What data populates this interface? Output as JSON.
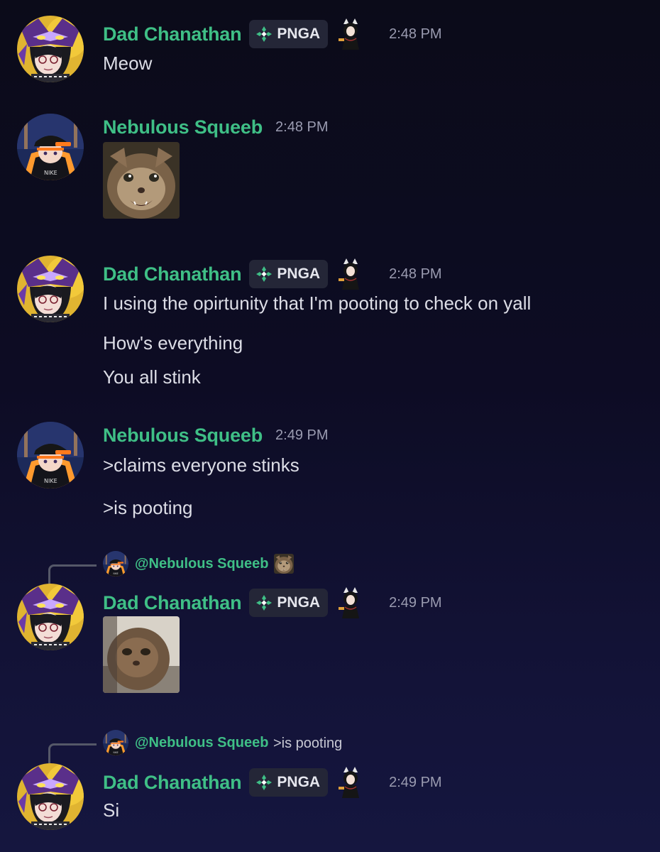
{
  "colors": {
    "username": "#3fbf86",
    "background_top": "#0b0b19",
    "background_bottom": "#15163f",
    "message_text": "#dcdde6",
    "timestamp": "#9a9bb0",
    "tag_background": "#242637"
  },
  "messages": [
    {
      "author": "Dad Chanathan",
      "tag": "PNGA",
      "tag_icon": "clan-badge-icon",
      "role_icon": "character-role-icon",
      "time": "2:48 PM",
      "lines": [
        "Meow"
      ]
    },
    {
      "author": "Nebulous Squeeb",
      "time": "2:48 PM",
      "attachment": "cat-image"
    },
    {
      "author": "Dad Chanathan",
      "tag": "PNGA",
      "time": "2:48 PM",
      "lines": [
        "I using the opirtunity that I'm pooting to check on yall",
        "How's everything",
        "You all stink"
      ]
    },
    {
      "author": "Nebulous Squeeb",
      "time": "2:49 PM",
      "lines": [
        ">claims everyone stinks",
        ">is pooting"
      ]
    },
    {
      "reply_to": "@Nebulous Squeeb",
      "reply_preview": "image",
      "author": "Dad Chanathan",
      "tag": "PNGA",
      "time": "2:49 PM",
      "attachment": "cat-image"
    },
    {
      "reply_to": "@Nebulous Squeeb",
      "reply_text": ">is pooting",
      "author": "Dad Chanathan",
      "tag": "PNGA",
      "time": "2:49 PM",
      "lines": [
        "Si"
      ]
    }
  ]
}
